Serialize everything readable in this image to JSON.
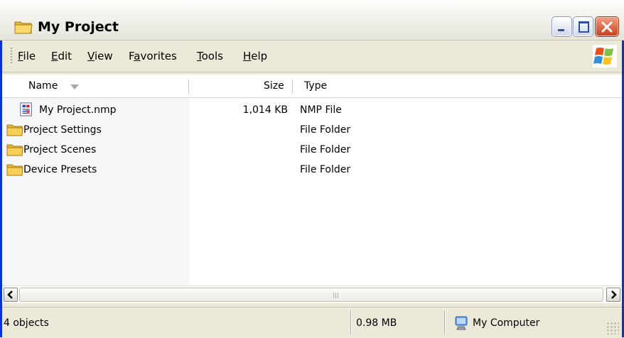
{
  "window": {
    "title": "My Project",
    "title_icon": "folder-icon",
    "controls": {
      "minimize": "minimize-icon",
      "maximize": "maximize-icon",
      "close": "close-icon"
    }
  },
  "menu": {
    "items": [
      {
        "label": "File",
        "underline": "F",
        "rest": "ile"
      },
      {
        "label": "Edit",
        "underline": "E",
        "rest": "dit"
      },
      {
        "label": "View",
        "underline": "V",
        "rest": "iew"
      },
      {
        "label": "Favorites",
        "pre": "F",
        "underline": "a",
        "rest": "vorites"
      },
      {
        "label": "Tools",
        "underline": "T",
        "rest": "ools"
      },
      {
        "label": "Help",
        "underline": "H",
        "rest": "elp"
      }
    ],
    "logo": "windows-logo-icon"
  },
  "columns": {
    "name": "Name",
    "size": "Size",
    "type": "Type",
    "sort_indicator": "sort-down-arrow-icon"
  },
  "files": [
    {
      "name": "My Project.nmp",
      "size": "1,014 KB",
      "type": "NMP File",
      "icon": "nmp-file-icon"
    },
    {
      "name": "Project Settings",
      "size": "",
      "type": "File Folder",
      "icon": "folder-icon"
    },
    {
      "name": "Project Scenes",
      "size": "",
      "type": "File Folder",
      "icon": "folder-icon"
    },
    {
      "name": "Device Presets",
      "size": "",
      "type": "File Folder",
      "icon": "folder-icon"
    }
  ],
  "status": {
    "objects": "4 objects",
    "total_size": "0.98 MB",
    "location": "My Computer",
    "location_icon": "my-computer-icon"
  },
  "colors": {
    "window_border": "#0831d9",
    "folder_yellow": "#f6cf57",
    "close_red": "#c9421d"
  }
}
